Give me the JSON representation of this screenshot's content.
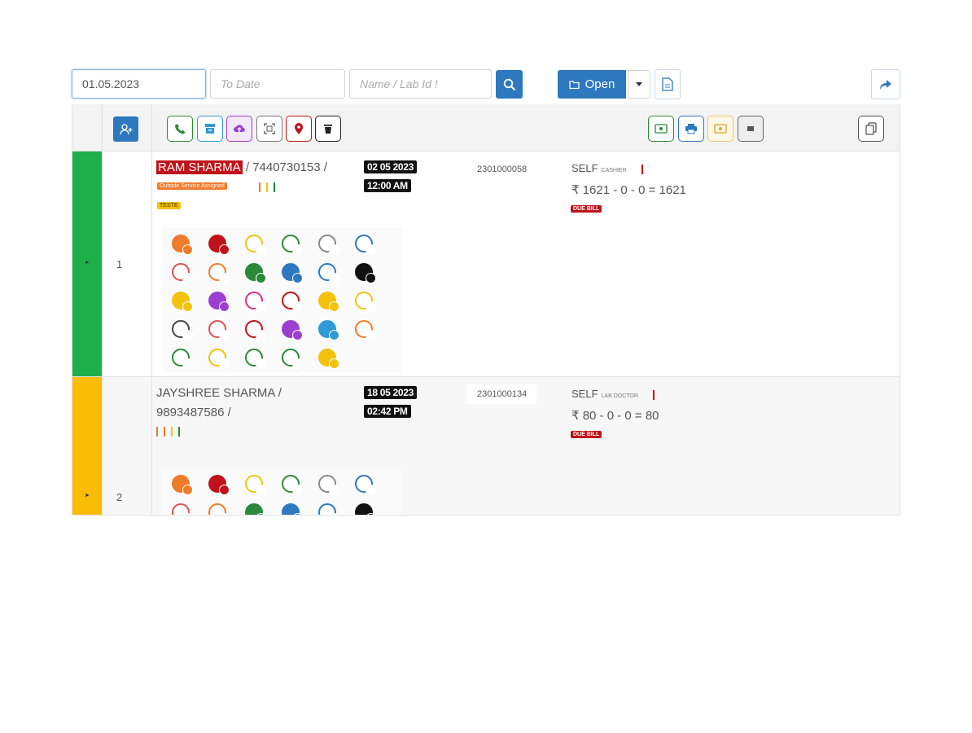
{
  "filters": {
    "from_date": "01.05.2023",
    "to_date_placeholder": "To Date",
    "search_placeholder": "Name / Lab Id !",
    "open_label": "Open"
  },
  "colors": {
    "primary": "#2e78bf",
    "row1_status": "#1db04a",
    "row2_status": "#fbbc05",
    "due_red": "#c0121a"
  },
  "header_icons": [
    "user-plus-icon",
    "phone-icon",
    "archive-icon",
    "cloud-upload-icon",
    "scan-icon",
    "map-pin-icon",
    "trash-icon",
    "money-icon",
    "printer-icon",
    "money-icon",
    "barcode-icon",
    "copy-icon"
  ],
  "rows": [
    {
      "num": "1",
      "name": "RAM SHARMA",
      "phone_suffix": " / 7440730153 /",
      "date": "02 05 2023",
      "time": "12:00 AM",
      "outside_tag": "Outside Service Assigned",
      "test_tag": "TESTE",
      "lab_id": "2301000058",
      "ref": "SELF",
      "ref_role": "CASHIER",
      "amount": "₹ 1621 - 0 - 0 = 1621",
      "due": "DUE BILL"
    },
    {
      "num": "2",
      "name_line1": "JAYSHREE SHARMA /",
      "name_line2": "9893487586 /",
      "date": "18 05 2023",
      "time": "02:42 PM",
      "lab_id": "2301000134",
      "ref": "SELF",
      "ref_role": "LAB DOCTOR",
      "amount": "₹ 80 - 0 - 0 = 80",
      "due": "DUE BILL"
    }
  ]
}
